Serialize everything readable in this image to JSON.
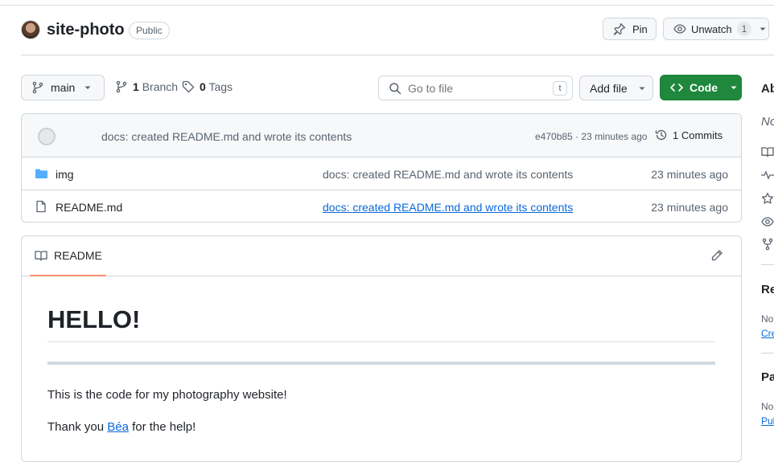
{
  "repo": {
    "name": "site-photo",
    "visibility": "Public"
  },
  "header_actions": {
    "pin_label": "Pin",
    "unwatch_label": "Unwatch",
    "watch_count": "1"
  },
  "toolbar": {
    "branch_name": "main",
    "branch_count": "1",
    "branch_label": "Branch",
    "tag_count": "0",
    "tag_label": "Tags",
    "search_placeholder": "Go to file",
    "search_shortcut": "t",
    "add_file_label": "Add file",
    "code_label": "Code"
  },
  "latest_commit": {
    "message": "docs: created README.md and wrote its contents",
    "hash_time": "e470b85 · 23 minutes ago",
    "commits_label": "1 Commits"
  },
  "files": [
    {
      "name": "img",
      "type": "folder",
      "commit": "docs: created README.md and wrote its contents",
      "time": "23 minutes ago"
    },
    {
      "name": "README.md",
      "type": "file",
      "commit": "docs: created README.md and wrote its contents",
      "time": "23 minutes ago"
    }
  ],
  "readme": {
    "tab_label": "README",
    "heading": "HELLO!",
    "paragraph1": "This is the code for my photography website!",
    "paragraph2_prefix": "Thank you ",
    "paragraph2_link": "Béa",
    "paragraph2_suffix": " for the help!"
  },
  "sidebar": {
    "about_heading": "Ab",
    "about_desc": "No",
    "releases_heading": "Re",
    "releases_text": "No",
    "releases_link": "Cre",
    "packages_heading": "Pa",
    "packages_text": "No",
    "packages_link": "Pul"
  },
  "colors": {
    "accent_green": "#1f883d",
    "link_blue": "#0969da",
    "tab_underline": "#fd8c73",
    "border": "#d0d7de"
  },
  "icons": [
    "branch-icon",
    "tag-icon",
    "search-icon",
    "pin-icon",
    "eye-icon",
    "code-icon",
    "history-icon",
    "folder-icon",
    "file-icon",
    "book-icon",
    "pencil-icon",
    "pulse-icon",
    "star-icon",
    "fork-icon"
  ]
}
